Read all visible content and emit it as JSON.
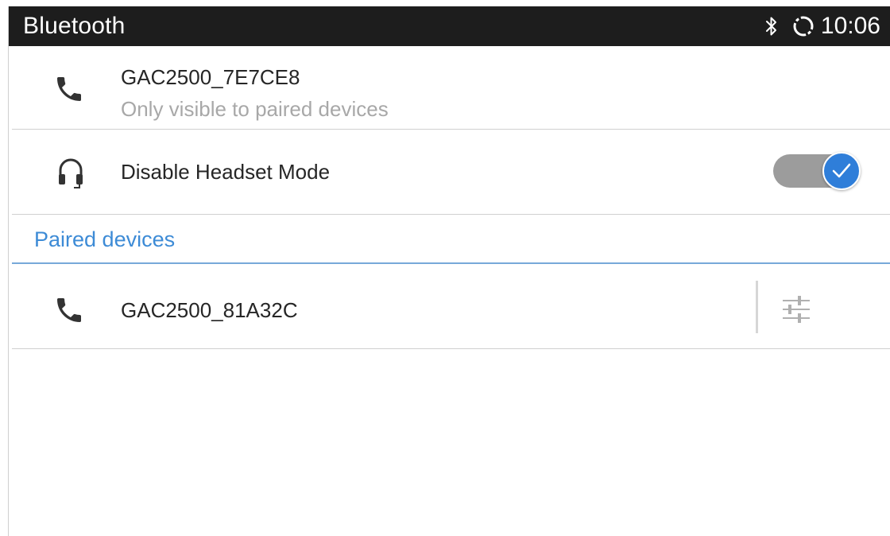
{
  "status_bar": {
    "title": "Bluetooth",
    "time": "10:06",
    "icons": [
      "bluetooth-icon",
      "sync-icon"
    ]
  },
  "local_device": {
    "name": "GAC2500_7E7CE8",
    "visibility": "Only visible to paired devices",
    "icon": "phone-icon"
  },
  "headset_mode": {
    "label": "Disable Headset Mode",
    "icon": "headset-icon",
    "enabled": true
  },
  "paired_section": {
    "header": "Paired devices",
    "devices": [
      {
        "name": "GAC2500_81A32C",
        "icon": "phone-icon",
        "action_icon": "settings-sliders-icon"
      }
    ]
  },
  "colors": {
    "accent": "#2f7ed9",
    "section_header": "#3d8bd6",
    "status_bar": "#1d1d1d",
    "toggle_track": "#9c9c9c",
    "secondary_text": "#a8a8a8"
  }
}
